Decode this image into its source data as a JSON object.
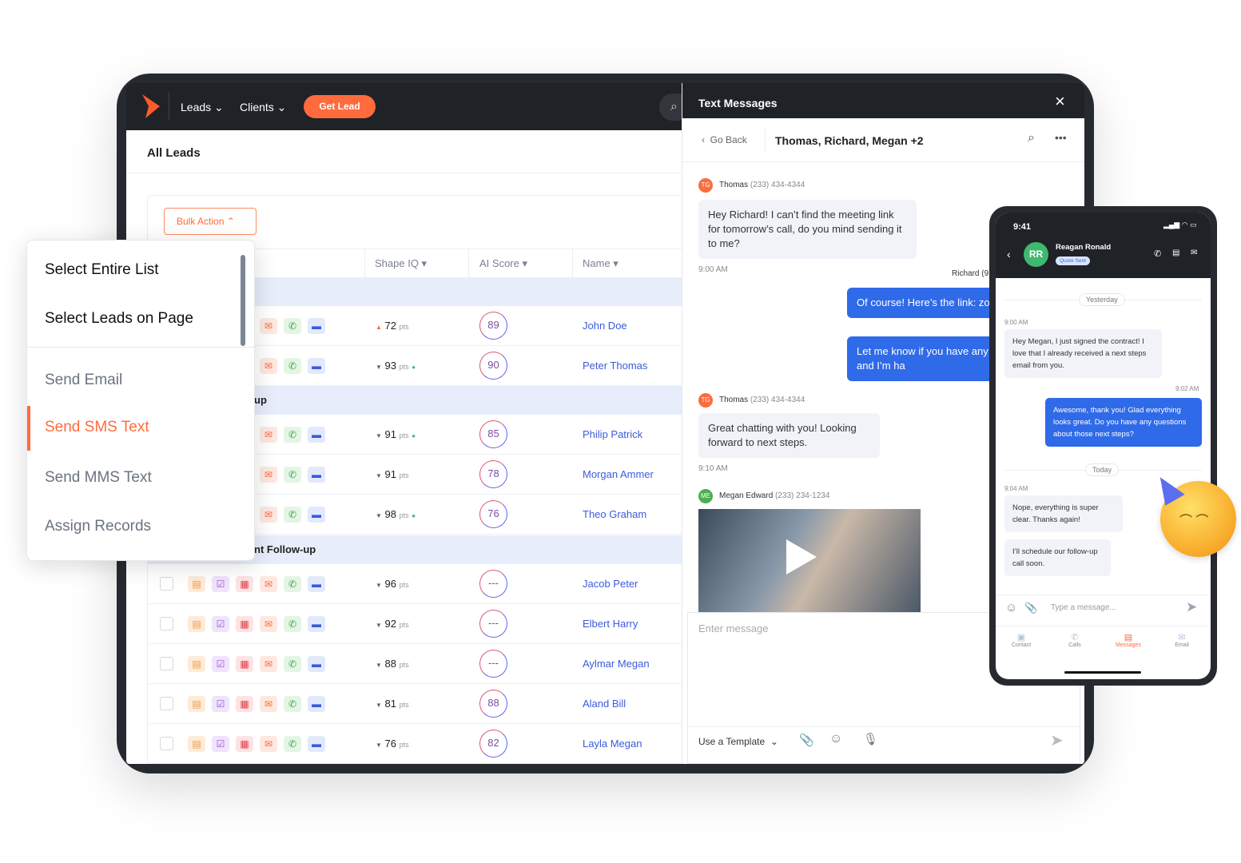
{
  "nav": {
    "items": [
      "Leads",
      "Clients"
    ],
    "cta": "Get Lead"
  },
  "page": {
    "title": "All Leads",
    "bulk_action": "Bulk Action"
  },
  "table": {
    "headers": [
      "Shape IQ",
      "AI Score",
      "Name"
    ],
    "pts_unit": "pts",
    "groups": [
      {
        "label": ""
      },
      {
        "label": "up"
      },
      {
        "label": "nt Follow-up"
      }
    ],
    "rows": [
      {
        "trend": "up",
        "pts": "72",
        "dot": false,
        "score": "89",
        "name": "John Doe",
        "group": 0
      },
      {
        "trend": "down",
        "pts": "93",
        "dot": true,
        "score": "90",
        "name": "Peter Thomas",
        "group": 0
      },
      {
        "trend": "down",
        "pts": "91",
        "dot": true,
        "score": "85",
        "name": "Philip Patrick",
        "group": 1
      },
      {
        "trend": "down",
        "pts": "91",
        "dot": false,
        "score": "78",
        "name": "Morgan Ammer",
        "group": 1
      },
      {
        "trend": "down",
        "pts": "98",
        "dot": true,
        "score": "76",
        "name": "Theo Graham",
        "group": 1
      },
      {
        "trend": "down",
        "pts": "96",
        "dot": false,
        "score": "---",
        "name": "Jacob Peter",
        "group": 2
      },
      {
        "trend": "down",
        "pts": "92",
        "dot": false,
        "score": "---",
        "name": "Elbert Harry",
        "group": 2
      },
      {
        "trend": "down",
        "pts": "88",
        "dot": false,
        "score": "---",
        "name": "Aylmar Megan",
        "group": 2
      },
      {
        "trend": "down",
        "pts": "81",
        "dot": false,
        "score": "88",
        "name": "Aland Bill",
        "group": 2
      },
      {
        "trend": "down",
        "pts": "76",
        "dot": false,
        "score": "82",
        "name": "Layla Megan",
        "group": 2
      }
    ]
  },
  "menu": {
    "items": [
      "Select Entire List",
      "Select Leads on Page",
      "Send Email",
      "Send SMS Text",
      "Send MMS Text",
      "Assign Records"
    ],
    "active": 3
  },
  "messages": {
    "title": "Text Messages",
    "go_back": "Go Back",
    "thread": "Thomas, Richard, Megan +2",
    "m1": {
      "initials": "TG",
      "name": "Thomas",
      "phone": "(233) 434-4344",
      "text": "Hey Richard! I can’t find the meeting link for tomorrow’s call, do you mind sending it to me?",
      "time": "9:00 AM"
    },
    "richard": "Richard (9",
    "m2": "Of course! Here’s the link: zoom.com/meeting",
    "m3": "Let me know if you have any issues getting in and I’m ha",
    "m4": {
      "initials": "TG",
      "name": "Thomas",
      "phone": "(233) 434-4344",
      "text": "Great chatting with you! Looking forward to next steps.",
      "time": "9:10 AM"
    },
    "m5": {
      "initials": "ME",
      "name": "Megan Edward",
      "phone": "(233) 234-1234"
    },
    "placeholder": "Enter message",
    "template": "Use a Template"
  },
  "phone": {
    "time": "9:41",
    "contact": "Reagan Ronald",
    "initials": "RR",
    "badge": "Quote Sent",
    "yesterday": "Yesterday",
    "today": "Today",
    "b1": {
      "time": "9:00 AM",
      "text": "Hey Megan, I just signed the contract! I love that I already received a next steps email from you."
    },
    "b2": {
      "time": "9:02 AM",
      "text": "Awesome, thank you! Glad everything looks great. Do you have any questions about those next steps?"
    },
    "b3": {
      "time": "9:04 AM",
      "text": "Nope, everything is super clear. Thanks again!"
    },
    "b4": "I’ll schedule our follow-up call soon.",
    "placeholder": "Type a message...",
    "tabs": [
      "Contact",
      "Calls",
      "Messages",
      "Email"
    ],
    "active_tab": 2
  },
  "colors": {
    "accent": "#ff6b3d",
    "blue": "#2f6ae8",
    "link": "#3b5bdb",
    "group": "#e8edfb"
  }
}
